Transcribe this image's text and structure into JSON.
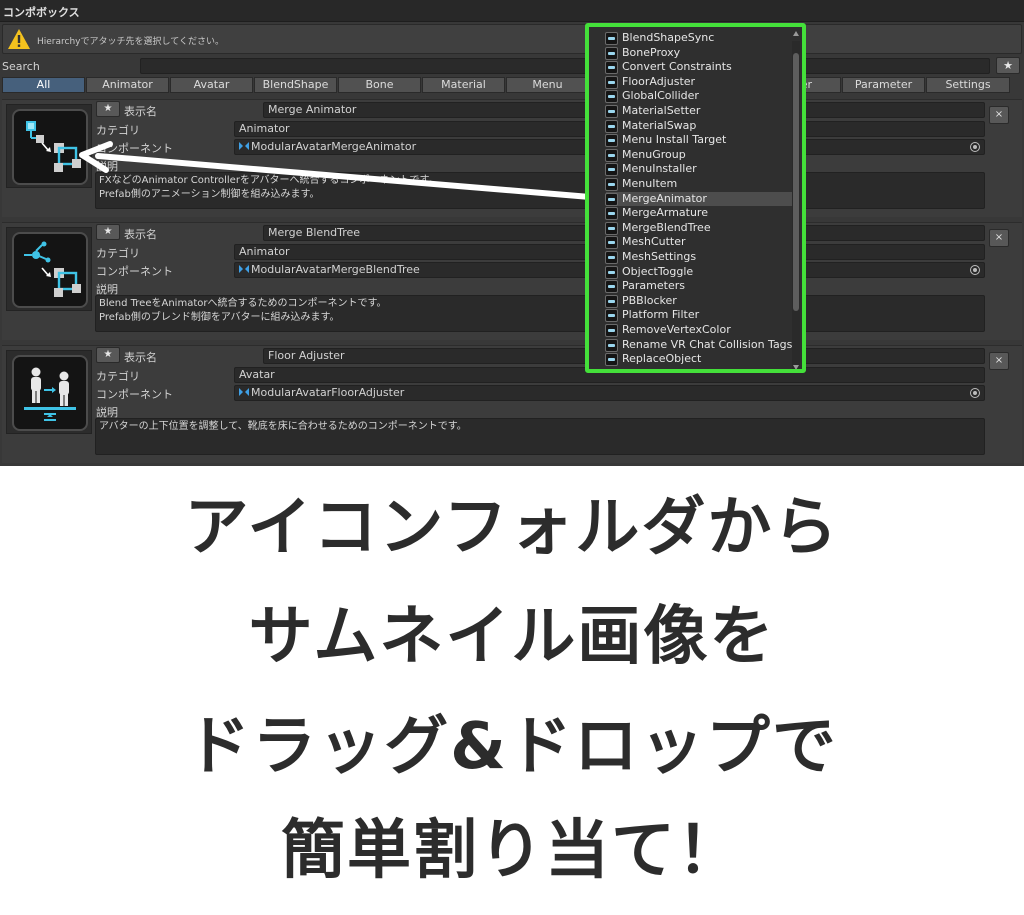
{
  "window": {
    "title": "コンポボックス"
  },
  "helpbox": {
    "icon": "warning-icon",
    "message": "Hierarchyでアタッチ先を選択してください。"
  },
  "search": {
    "label": "Search",
    "value": "",
    "favorite_label": "★"
  },
  "tabs": [
    {
      "label": "All",
      "active": true
    },
    {
      "label": "Animator"
    },
    {
      "label": "Avatar"
    },
    {
      "label": "BlendShape"
    },
    {
      "label": "Bone"
    },
    {
      "label": "Material"
    },
    {
      "label": "Menu"
    },
    {
      "label": ""
    },
    {
      "label": ""
    },
    {
      "label": "her"
    },
    {
      "label": "Parameter"
    },
    {
      "label": "Settings"
    }
  ],
  "labels": {
    "favorite": "★",
    "display_name": "表示名",
    "category": "カテゴリ",
    "component": "コンポーネント",
    "description": "説明",
    "remove": "×"
  },
  "entries": [
    {
      "icon": "merge-animator-icon",
      "display_name": "Merge Animator",
      "category": "Animator",
      "component": "ModularAvatarMergeAnimator",
      "description": "FXなどのAnimator Controllerをアバターへ統合するコンポーネントです。\nPrefab側のアニメーション制御を組み込みます。"
    },
    {
      "icon": "merge-blendtree-icon",
      "display_name": "Merge BlendTree",
      "category": "Animator",
      "component": "ModularAvatarMergeBlendTree",
      "description": "Blend TreeをAnimatorへ統合するためのコンポーネントです。\nPrefab側のブレンド制御をアバターに組み込みます。"
    },
    {
      "icon": "floor-adjuster-icon",
      "display_name": "Floor Adjuster",
      "category": "Avatar",
      "component": "ModularAvatarFloorAdjuster",
      "description": "アバターの上下位置を調整して、靴底を床に合わせるためのコンポーネントです。"
    }
  ],
  "dropdown": {
    "selected": "MergeAnimator",
    "items": [
      "BlendShapeSync",
      "BoneProxy",
      "Convert Constraints",
      "FloorAdjuster",
      "GlobalCollider",
      "MaterialSetter",
      "MaterialSwap",
      "Menu Install Target",
      "MenuGroup",
      "MenuInstaller",
      "MenuItem",
      "MergeAnimator",
      "MergeArmature",
      "MergeBlendTree",
      "MeshCutter",
      "MeshSettings",
      "ObjectToggle",
      "Parameters",
      "PBBlocker",
      "Platform Filter",
      "RemoveVertexColor",
      "Rename VR Chat Collision Tags",
      "ReplaceObject"
    ]
  },
  "colors": {
    "highlight_border": "#44e03a",
    "accent": "#46607c",
    "icon_cyan": "#3fc3e6"
  },
  "caption": {
    "lines": [
      "アイコンフォルダから",
      "サムネイル画像を",
      "ドラッグ&ドロップで",
      "簡単割り当て！"
    ]
  }
}
